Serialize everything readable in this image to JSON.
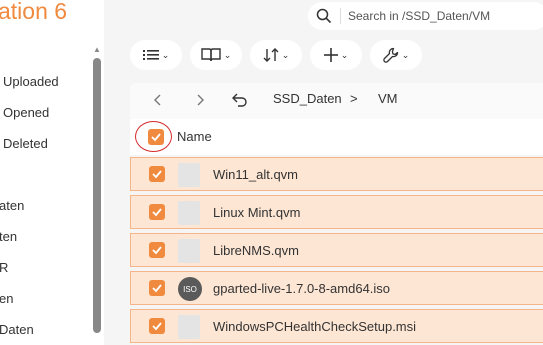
{
  "sidebar": {
    "app_title": "ation 6",
    "items": [
      {
        "label": "Uploaded"
      },
      {
        "label": "Opened"
      },
      {
        "label": "Deleted"
      },
      {
        "label": "aten"
      },
      {
        "label": "ten"
      },
      {
        "label": "R"
      },
      {
        "label": "en"
      },
      {
        "label": "Daten"
      }
    ]
  },
  "search": {
    "placeholder": "Search in /SSD_Daten/VM"
  },
  "toolbar": {
    "buttons": [
      {
        "icon": "list-view-icon"
      },
      {
        "icon": "book-icon"
      },
      {
        "icon": "sort-icon"
      },
      {
        "icon": "plus-icon"
      },
      {
        "icon": "wrench-icon"
      }
    ]
  },
  "breadcrumb": {
    "folder": "SSD_Daten",
    "separator": ">",
    "current": "VM"
  },
  "table": {
    "header_name": "Name",
    "rows": [
      {
        "name": "Win11_alt.qvm",
        "icon": "file-icon",
        "checked": true
      },
      {
        "name": "Linux Mint.qvm",
        "icon": "file-icon",
        "checked": true
      },
      {
        "name": "LibreNMS.qvm",
        "icon": "file-icon",
        "checked": true
      },
      {
        "name": "gparted-live-1.7.0-8-amd64.iso",
        "icon": "iso-icon",
        "icon_text": "ISO",
        "checked": true
      },
      {
        "name": "WindowsPCHealthCheckSetup.msi",
        "icon": "file-icon",
        "checked": true
      }
    ]
  },
  "colors": {
    "accent": "#f08a3e",
    "selected_row": "#fde6d4",
    "annotation": "#d52b2b"
  }
}
